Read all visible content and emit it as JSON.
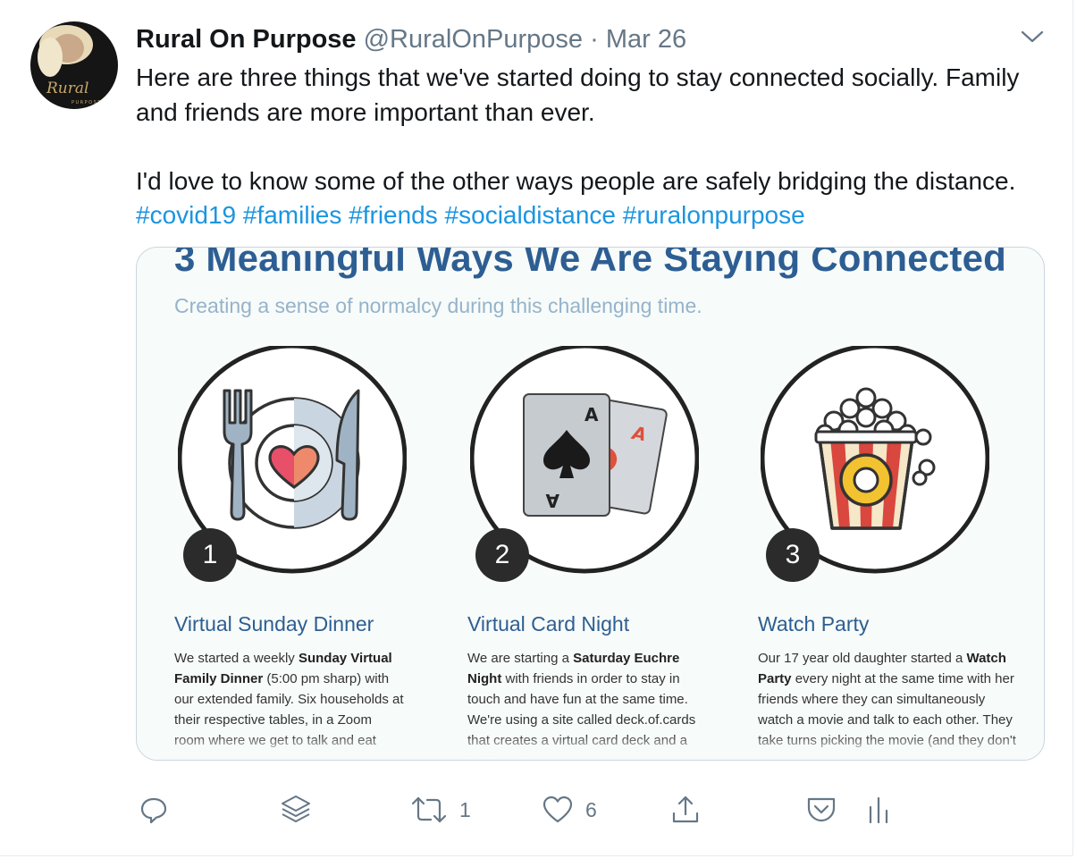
{
  "tweet": {
    "display_name": "Rural On Purpose",
    "handle": "@RuralOnPurpose",
    "separator": "·",
    "date": "Mar 26",
    "text_line1": "Here are three things that we've started doing to stay connected socially. Family and friends are more important than ever.",
    "text_line2": "I'd love to know some of the other ways people are safely bridging the distance.",
    "hashtags": [
      "#covid19",
      "#families",
      "#friends",
      "#socialdistance",
      "#ruralonpurpose"
    ]
  },
  "infographic": {
    "title": "3 Meaningful Ways We Are Staying Connected",
    "subtitle": "Creating a sense of normalcy during this challenging time.",
    "items": [
      {
        "number": "1",
        "title": "Virtual Sunday Dinner",
        "body_parts": [
          "We started a weekly ",
          "Sunday Virtual Family Dinner",
          " (5:00 pm sharp) with our extended family. Six households at their respective tables, in a Zoom room where we get to talk and eat together. It gives everyone a regular"
        ]
      },
      {
        "number": "2",
        "title": "Virtual Card Night",
        "body_parts": [
          "We are starting a ",
          "Saturday Euchre Night",
          " with friends in order to stay in touch and have fun at the same time. We're using a site called deck.of.cards that creates a virtual card deck and a link for others to join"
        ]
      },
      {
        "number": "3",
        "title": "Watch Party",
        "body_parts": [
          "Our 17 year old daughter started a ",
          "Watch Party",
          " every night at the same time with her friends where they can simultaneously watch a movie and talk to each other. They take turns picking the movie (and they don't have to share"
        ]
      }
    ],
    "card_letters": {
      "front": "A",
      "back": "A"
    }
  },
  "actions": {
    "retweet_count": "1",
    "like_count": "6",
    "icons": [
      "reply-icon",
      "layers-icon",
      "retweet-icon",
      "like-icon",
      "share-icon",
      "pocket-icon",
      "analytics-icon"
    ]
  },
  "colors": {
    "link": "#1b95e0",
    "muted": "#657786",
    "infographic_title": "#2d5e93",
    "infographic_subtitle": "#95b3cb",
    "heart": "#e8506a",
    "popcorn_red": "#d9473e"
  }
}
